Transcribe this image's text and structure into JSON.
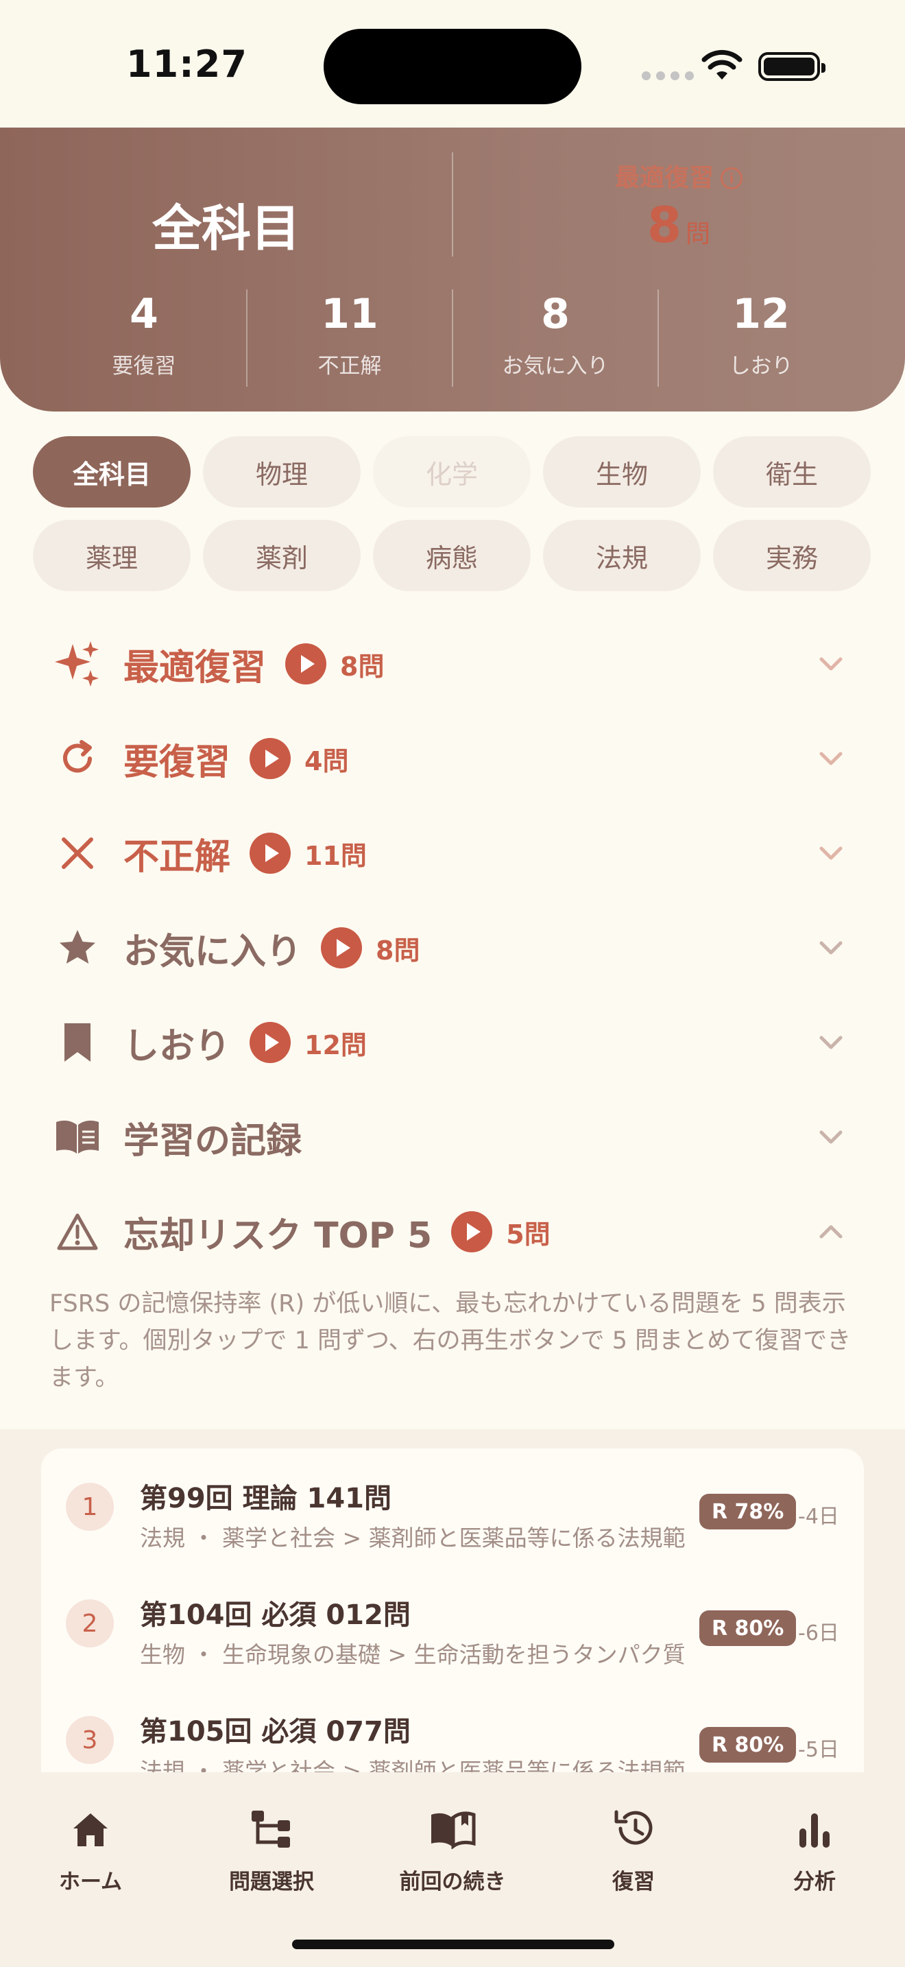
{
  "status_bar": {
    "time": "11:27"
  },
  "header": {
    "title": "全科目",
    "optimal_label": "最適復習",
    "optimal_info": "i",
    "optimal_count": "8",
    "optimal_unit": "問",
    "stats": [
      {
        "value": "4",
        "label": "要復習"
      },
      {
        "value": "11",
        "label": "不正解"
      },
      {
        "value": "8",
        "label": "お気に入り"
      },
      {
        "value": "12",
        "label": "しおり"
      }
    ]
  },
  "subjects": [
    "全科目",
    "物理",
    "化学",
    "生物",
    "衛生",
    "薬理",
    "薬剤",
    "病態",
    "法規",
    "実務"
  ],
  "subjects_active": "全科目",
  "subjects_disabled": "化学",
  "sections": [
    {
      "title": "最適復習",
      "count": "8問",
      "icon": "sparkles-icon"
    },
    {
      "title": "要復習",
      "count": "4問",
      "icon": "refresh-icon"
    },
    {
      "title": "不正解",
      "count": "11問",
      "icon": "x-mark-icon"
    },
    {
      "title": "お気に入り",
      "count": "8問",
      "icon": "star-icon"
    },
    {
      "title": "しおり",
      "count": "12問",
      "icon": "bookmark-icon"
    },
    {
      "title": "学習の記録",
      "count": "",
      "icon": "book-icon"
    },
    {
      "title": "忘却リスク TOP 5",
      "count": "5問",
      "icon": "warning-icon"
    }
  ],
  "risk_description": "FSRS の記憶保持率 (R) が低い順に、最も忘れかけている問題を 5 問表示します。個別タップで 1 問ずつ、右の再生ボタンで 5 問まとめて復習できます。",
  "risk_items": [
    {
      "rank": "1",
      "title": "第99回 理論 141問",
      "path": "法規 ・ 薬学と社会 > 薬剤師と医薬品等に係る法規範",
      "retention": "R 78%",
      "days": "-4日"
    },
    {
      "rank": "2",
      "title": "第104回 必須 012問",
      "path": "生物 ・ 生命現象の基礎 > 生命活動を担うタンパク質",
      "retention": "R 80%",
      "days": "-6日"
    },
    {
      "rank": "3",
      "title": "第105回 必須 077問",
      "path": "法規 ・ 薬学と社会 > 薬剤師と医薬品等に係る法規範",
      "retention": "R 80%",
      "days": "-5日"
    }
  ],
  "tabs": [
    {
      "label": "ホーム",
      "icon": "home-icon"
    },
    {
      "label": "問題選択",
      "icon": "tree-icon"
    },
    {
      "label": "前回の続き",
      "icon": "open-book-icon"
    },
    {
      "label": "復習",
      "icon": "history-icon"
    },
    {
      "label": "分析",
      "icon": "bar-chart-icon"
    }
  ],
  "colors": {
    "accent": "#c95a45",
    "brand": "#8f665a",
    "background": "#fdfaf1"
  }
}
